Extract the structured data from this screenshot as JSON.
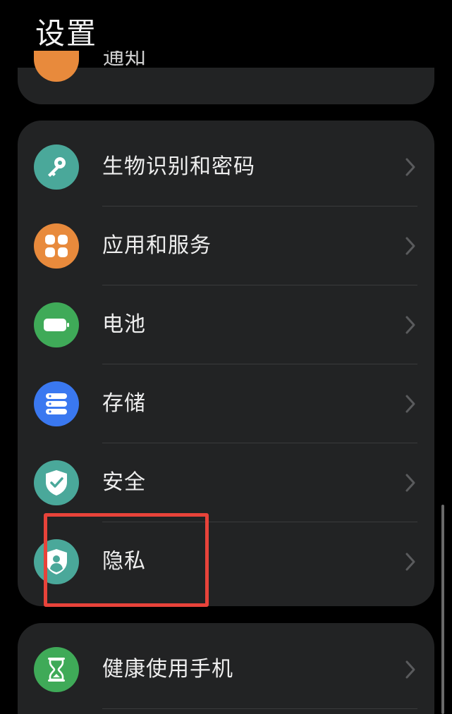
{
  "header": {
    "title": "设置"
  },
  "partial_item": {
    "label": "通知",
    "icon": "bell-icon",
    "color": "#e88a3c"
  },
  "main_group": {
    "items": [
      {
        "label": "生物识别和密码",
        "icon": "key-icon",
        "color": "#4aa89a"
      },
      {
        "label": "应用和服务",
        "icon": "grid-icon",
        "color": "#e88a3c"
      },
      {
        "label": "电池",
        "icon": "battery-icon",
        "color": "#3faa58"
      },
      {
        "label": "存储",
        "icon": "storage-icon",
        "color": "#3a78f0"
      },
      {
        "label": "安全",
        "icon": "shield-check-icon",
        "color": "#4aa89a"
      },
      {
        "label": "隐私",
        "icon": "privacy-shield-icon",
        "color": "#4aa89a"
      }
    ]
  },
  "bottom_group": {
    "items": [
      {
        "label": "健康使用手机",
        "icon": "hourglass-icon",
        "color": "#3faa58"
      }
    ]
  },
  "annotation": {
    "color": "#e8433a",
    "target": "隐私"
  }
}
